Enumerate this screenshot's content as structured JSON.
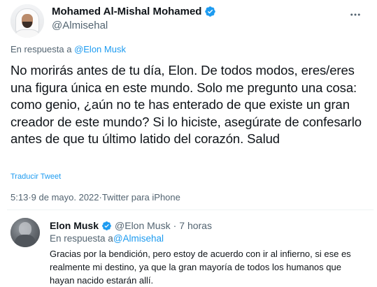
{
  "tweet": {
    "display_name": "Mohamed Al-Mishal Mohamed",
    "handle": "@Almisehal",
    "reply_prefix": "En respuesta a ",
    "reply_to": "@Elon Musk",
    "text": "No morirás antes de tu día, Elon. De todos modos, eres/eres una figura única en este mundo. Solo me pregunto una cosa: como genio, ¿aún no te has enterado de que existe un gran creador de este mundo? Si lo hiciste, asegúrate de confesarlo antes de que tu último latido del corazón. Salud",
    "translate_label": "Traducir Tweet",
    "time": "5:13",
    "date": "9 de mayo. 2022",
    "source": "Twitter para iPhone",
    "separator": " · "
  },
  "reply": {
    "display_name": "Elon Musk",
    "handle": "@Elon Musk",
    "dot": "·",
    "time": "7 horas",
    "reply_prefix": "En respuesta a",
    "reply_to": "@Almisehal",
    "text": "Gracias por la bendición, pero estoy de acuerdo con ir al infierno, si ese es realmente mi destino, ya que la gran mayoría de todos los humanos que hayan nacido estarán allí."
  },
  "colors": {
    "link": "#1d9bf0",
    "secondary": "#536471",
    "primary_text": "#0f1419",
    "divider": "#eff3f4"
  },
  "icons": [
    "verified-badge-icon",
    "more-options-icon"
  ]
}
